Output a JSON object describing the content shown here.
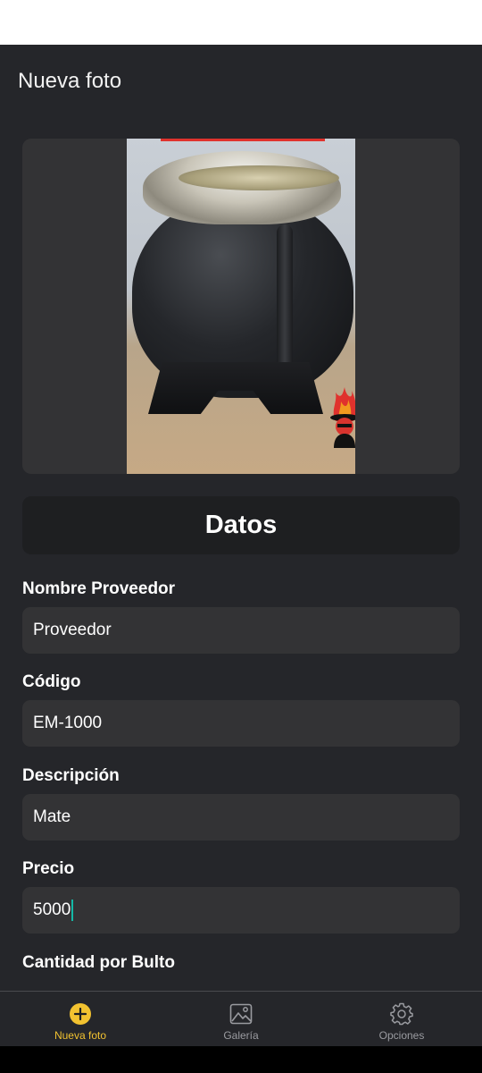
{
  "header": {
    "title": "Nueva foto"
  },
  "datos_title": "Datos",
  "form": {
    "proveedor": {
      "label": "Nombre Proveedor",
      "value": "Proveedor"
    },
    "codigo": {
      "label": "Código",
      "value": "EM-1000"
    },
    "descripcion": {
      "label": "Descripción",
      "value": "Mate"
    },
    "precio": {
      "label": "Precio",
      "value": "5000"
    },
    "cantidad": {
      "label": "Cantidad por Bulto"
    }
  },
  "nav": {
    "items": [
      {
        "label": "Nueva foto",
        "icon": "plus-circle-icon",
        "active": true
      },
      {
        "label": "Galería",
        "icon": "image-icon",
        "active": false
      },
      {
        "label": "Opciones",
        "icon": "gear-icon",
        "active": false
      }
    ]
  },
  "colors": {
    "background": "#25262a",
    "field": "#333335",
    "accent": "#f2c230",
    "caret": "#14b8a6"
  }
}
